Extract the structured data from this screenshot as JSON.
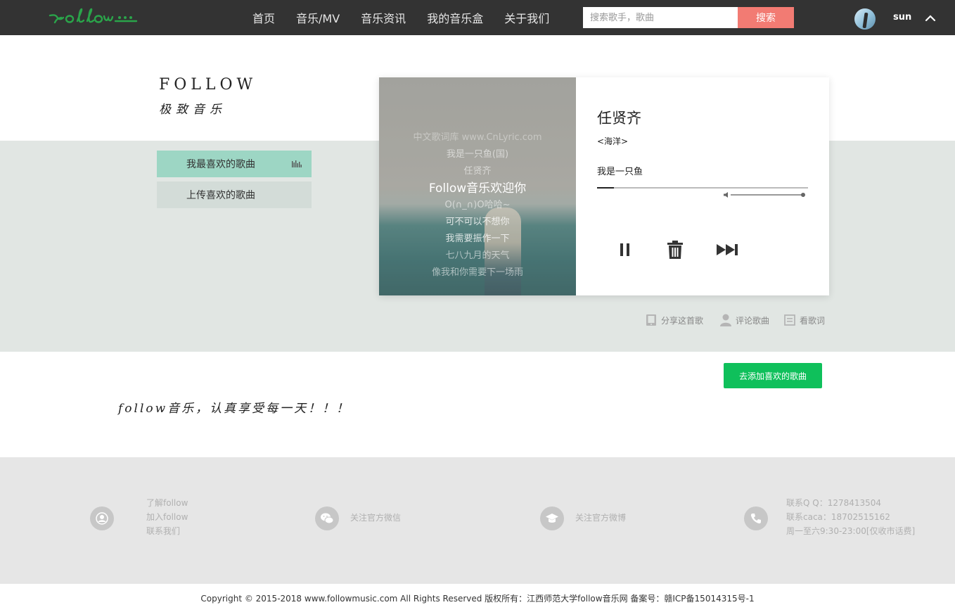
{
  "header": {
    "logo_text": "follow",
    "nav": [
      "首页",
      "音乐/MV",
      "音乐资讯",
      "我的音乐盒",
      "关于我们"
    ],
    "search": {
      "placeholder": "搜索歌手，歌曲",
      "value": "",
      "button": "搜索"
    },
    "user": {
      "name": "sun"
    }
  },
  "brand": {
    "title": "FOLLOW",
    "subtitle": "极致音乐"
  },
  "sidebar": {
    "tabs": [
      {
        "label": "我最喜欢的歌曲",
        "active": true
      },
      {
        "label": "上传喜欢的歌曲",
        "active": false
      }
    ]
  },
  "player": {
    "lyrics": [
      "中文歌词库 www.CnLyric.com",
      "我是一只鱼(国)",
      "任贤齐",
      "Follow音乐欢迎你",
      "O(∩_∩)O哈哈~",
      "可不可以不想你",
      "我需要振作一下",
      "七八九月的天气",
      "像我和你需要下一场雨"
    ],
    "artist": "任贤齐",
    "album": "<海洋>",
    "song": "我是一只鱼",
    "progress": 0.08,
    "volume": 1.0,
    "controls": [
      "pause-icon",
      "trash-icon",
      "next-icon"
    ]
  },
  "actions": [
    "分享这首歌",
    "评论歌曲",
    "看歌词"
  ],
  "add_button": "去添加喜欢的歌曲",
  "slogan": "follow音乐，认真享受每一天！！！",
  "footer": {
    "col1": [
      "了解follow",
      "加入follow",
      "联系我们"
    ],
    "col2": "关注官方微信",
    "col3": "关注官方微博",
    "col4": [
      "联系Q Q：1278413504",
      "联系caca：18702515162",
      "周一至六9:30-23:00[仅收市话费]"
    ],
    "copyright": "Copyright © 2015-2018 www.followmusic.com All Rights Reserved 版权所有：江西师范大学follow音乐网 备案号：赣ICP备15014315号-1"
  },
  "colors": {
    "nav_bg": "#333333",
    "search_button": "#f27b73",
    "active_tab": "#9dd6c4",
    "band_bg": "#e1e6e3",
    "add_button": "#0fc05b",
    "logo": "#2aa44a",
    "footer_bg": "#e6e6e6"
  }
}
